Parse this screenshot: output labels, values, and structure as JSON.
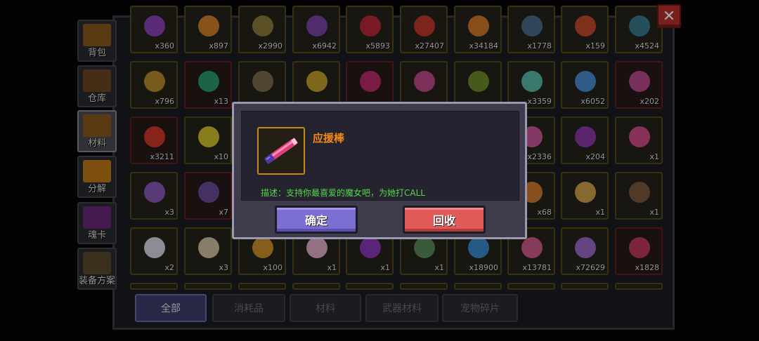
{
  "close_label": "✕",
  "side_tabs": [
    {
      "label": "背包",
      "icon": "backpack-icon",
      "color": "#8a5a1e"
    },
    {
      "label": "仓库",
      "icon": "warehouse-icon",
      "color": "#6a4622"
    },
    {
      "label": "材料",
      "icon": "materials-icon",
      "color": "#8a5a1e"
    },
    {
      "label": "分解",
      "icon": "decompose-icon",
      "color": "#c07a18"
    },
    {
      "label": "魂卡",
      "icon": "soul-card-icon",
      "color": "#6a2a7a"
    },
    {
      "label": "装备方案",
      "icon": "equipment-plan-icon",
      "color": "#5a4a2a"
    }
  ],
  "items": [
    [
      {
        "qty": "x360",
        "color": "#8a44b8",
        "border": "gold"
      },
      {
        "qty": "x897",
        "color": "#d0802a",
        "border": "gold"
      },
      {
        "qty": "x2990",
        "color": "#8a7a3a",
        "border": "gold"
      },
      {
        "qty": "x6942",
        "color": "#7a44a8",
        "border": "gold"
      },
      {
        "qty": "x5893",
        "color": "#b82a3a",
        "border": "gold"
      },
      {
        "qty": "x27407",
        "color": "#c0392b",
        "border": "gold"
      },
      {
        "qty": "x34184",
        "color": "#d0782a",
        "border": "gold"
      },
      {
        "qty": "x1778",
        "color": "#4a6a8a",
        "border": "gold"
      },
      {
        "qty": "x159",
        "color": "#c04a2a",
        "border": "gold"
      },
      {
        "qty": "x4524",
        "color": "#3a7a8a",
        "border": "gold"
      }
    ],
    [
      {
        "qty": "x796",
        "color": "#b88a2a",
        "border": "gold"
      },
      {
        "qty": "x13",
        "color": "#2a9a6a",
        "border": "red"
      },
      {
        "qty": "",
        "color": "#7a6a4a",
        "border": "gold"
      },
      {
        "qty": "",
        "color": "#c0a02a",
        "border": "gold"
      },
      {
        "qty": "",
        "color": "#b82a6a",
        "border": "red"
      },
      {
        "qty": "",
        "color": "#c04a8a",
        "border": "gold"
      },
      {
        "qty": "",
        "color": "#6a8a2a",
        "border": "gold"
      },
      {
        "qty": "x3359",
        "color": "#5ab8a8",
        "border": "gold"
      },
      {
        "qty": "x6052",
        "color": "#4a8ad0",
        "border": "gold"
      },
      {
        "qty": "x202",
        "color": "#b84a8a",
        "border": "red"
      }
    ],
    [
      {
        "qty": "x3211",
        "color": "#d03a2a",
        "border": "red"
      },
      {
        "qty": "x10",
        "color": "#d0c02a",
        "border": "gold"
      },
      {
        "qty": "",
        "color": "#5a5a5a",
        "border": "gold"
      },
      {
        "qty": "",
        "color": "#5a5a5a",
        "border": "gold"
      },
      {
        "qty": "",
        "color": "#5a5a5a",
        "border": "gold"
      },
      {
        "qty": "",
        "color": "#5a5a5a",
        "border": "gold"
      },
      {
        "qty": "",
        "color": "#5a5a5a",
        "border": "gold"
      },
      {
        "qty": "x2336",
        "color": "#c85a9a",
        "border": "gold"
      },
      {
        "qty": "x204",
        "color": "#8a3aa8",
        "border": "gold"
      },
      {
        "qty": "x1",
        "color": "#d04a8a",
        "border": "gold"
      }
    ],
    [
      {
        "qty": "x3",
        "color": "#8a5ab8",
        "border": "gold"
      },
      {
        "qty": "x7",
        "color": "#6a4a9a",
        "border": "red"
      },
      {
        "qty": "",
        "color": "#5a5a5a",
        "border": "gold"
      },
      {
        "qty": "",
        "color": "#5a5a5a",
        "border": "gold"
      },
      {
        "qty": "",
        "color": "#5a5a5a",
        "border": "gold"
      },
      {
        "qty": "",
        "color": "#5a5a5a",
        "border": "gold"
      },
      {
        "qty": "",
        "color": "#5a5a5a",
        "border": "gold"
      },
      {
        "qty": "x68",
        "color": "#d07a2a",
        "border": "gold"
      },
      {
        "qty": "x1",
        "color": "#d0a04a",
        "border": "gold"
      },
      {
        "qty": "x1",
        "color": "#7a5a3a",
        "border": "gold"
      }
    ],
    [
      {
        "qty": "x2",
        "color": "#d8d8e8",
        "border": "gold"
      },
      {
        "qty": "x3",
        "color": "#d0c0a0",
        "border": "gold"
      },
      {
        "qty": "x100",
        "color": "#d0902a",
        "border": "gold"
      },
      {
        "qty": "x1",
        "color": "#e0b0c8",
        "border": "gold"
      },
      {
        "qty": "x1",
        "color": "#8a3ab8",
        "border": "gold"
      },
      {
        "qty": "x1",
        "color": "#5a8a5a",
        "border": "gold"
      },
      {
        "qty": "x18900",
        "color": "#3a8ad0",
        "border": "gold"
      },
      {
        "qty": "x13781",
        "color": "#d05a8a",
        "border": "gold"
      },
      {
        "qty": "x72629",
        "color": "#9a6ac8",
        "border": "gold"
      },
      {
        "qty": "x1828",
        "color": "#c03a5a",
        "border": "red"
      }
    ],
    [
      {
        "qty": "",
        "color": "#3a3a3a",
        "border": "gold"
      },
      {
        "qty": "",
        "color": "#3a3a3a",
        "border": "gold"
      },
      {
        "qty": "",
        "color": "#3a3a3a",
        "border": "gold"
      },
      {
        "qty": "",
        "color": "#3a3a3a",
        "border": "gold"
      },
      {
        "qty": "",
        "color": "#3a3a3a",
        "border": "gold"
      },
      {
        "qty": "",
        "color": "#3a3a3a",
        "border": "gold"
      },
      {
        "qty": "",
        "color": "#3a3a3a",
        "border": "gold"
      },
      {
        "qty": "",
        "color": "#3a3a3a",
        "border": "gold"
      },
      {
        "qty": "",
        "color": "#3a3a3a",
        "border": "gold"
      },
      {
        "qty": "",
        "color": "#3a3a3a",
        "border": "gold"
      }
    ]
  ],
  "category_tabs": [
    {
      "label": "全部",
      "active": true
    },
    {
      "label": "消耗品",
      "active": false
    },
    {
      "label": "材料",
      "active": false
    },
    {
      "label": "武器材料",
      "active": false
    },
    {
      "label": "宠物碎片",
      "active": false
    }
  ],
  "dialog": {
    "item_name": "应援棒",
    "item_icon": "cheer-stick-icon",
    "description": "描述：支持你最喜爱的魔女吧，为她打CALL",
    "confirm_label": "确定",
    "recycle_label": "回收"
  },
  "colors": {
    "name": "#f08a16",
    "description": "#52d84a",
    "confirm_button": "#7b6fd2",
    "recycle_button": "#e05a5a"
  }
}
